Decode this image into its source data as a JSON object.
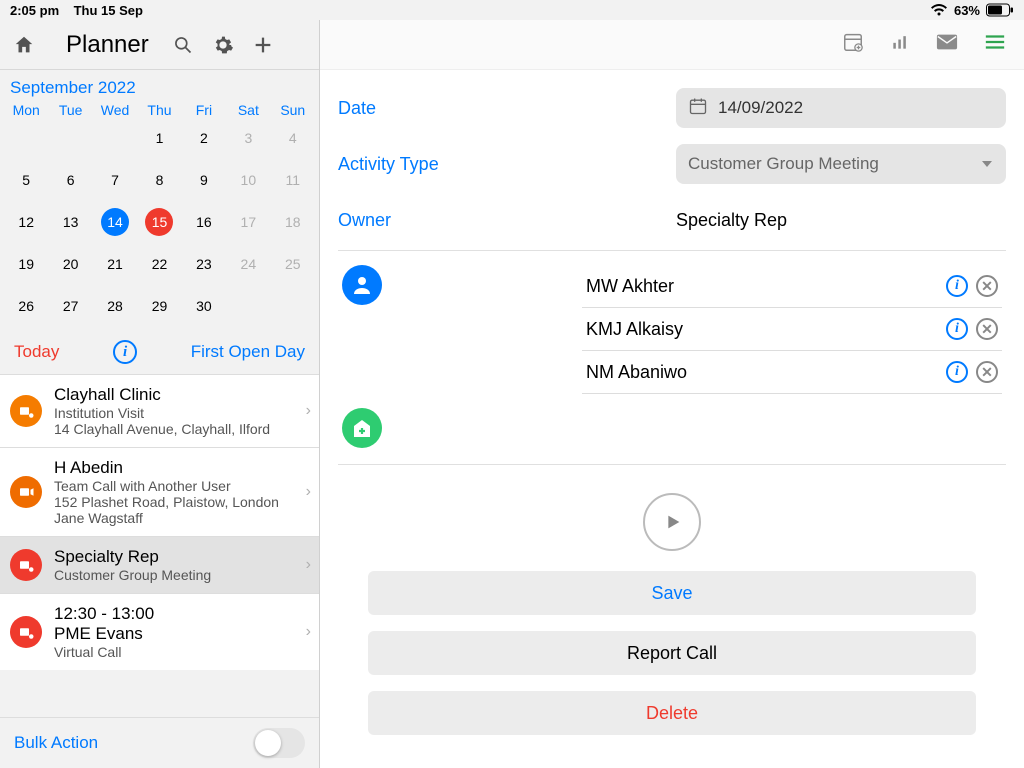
{
  "status": {
    "time": "2:05 pm",
    "date": "Thu 15 Sep",
    "battery": "63%"
  },
  "header": {
    "title": "Planner"
  },
  "calendar": {
    "month_link": "September 2022",
    "weekdays": [
      "Mon",
      "Tue",
      "Wed",
      "Thu",
      "Fri",
      "Sat",
      "Sun"
    ]
  },
  "midrow": {
    "today": "Today",
    "first_open": "First Open Day"
  },
  "events": [
    {
      "title": "Clayhall Clinic",
      "line2": "Institution Visit",
      "line3": "14 Clayhall Avenue,  Clayhall, Ilford"
    },
    {
      "title": "H Abedin",
      "line2": "Team Call with Another User",
      "line3": "152 Plashet Road,  Plaistow, London",
      "line4": "Jane Wagstaff"
    },
    {
      "title": "Specialty Rep",
      "line2": "Customer Group Meeting"
    },
    {
      "title_pre": "12:30 - 13:00",
      "title": "PME Evans",
      "line2": "Virtual Call"
    }
  ],
  "bulk": {
    "label": "Bulk Action"
  },
  "detail": {
    "date_label": "Date",
    "date_value": "14/09/2022",
    "activity_label": "Activity Type",
    "activity_value": "Customer Group Meeting",
    "owner_label": "Owner",
    "owner_value": "Specialty Rep",
    "persons": [
      "MW Akhter",
      "KMJ Alkaisy",
      "NM Abaniwo"
    ],
    "buttons": {
      "save": "Save",
      "report": "Report Call",
      "delete": "Delete"
    }
  }
}
